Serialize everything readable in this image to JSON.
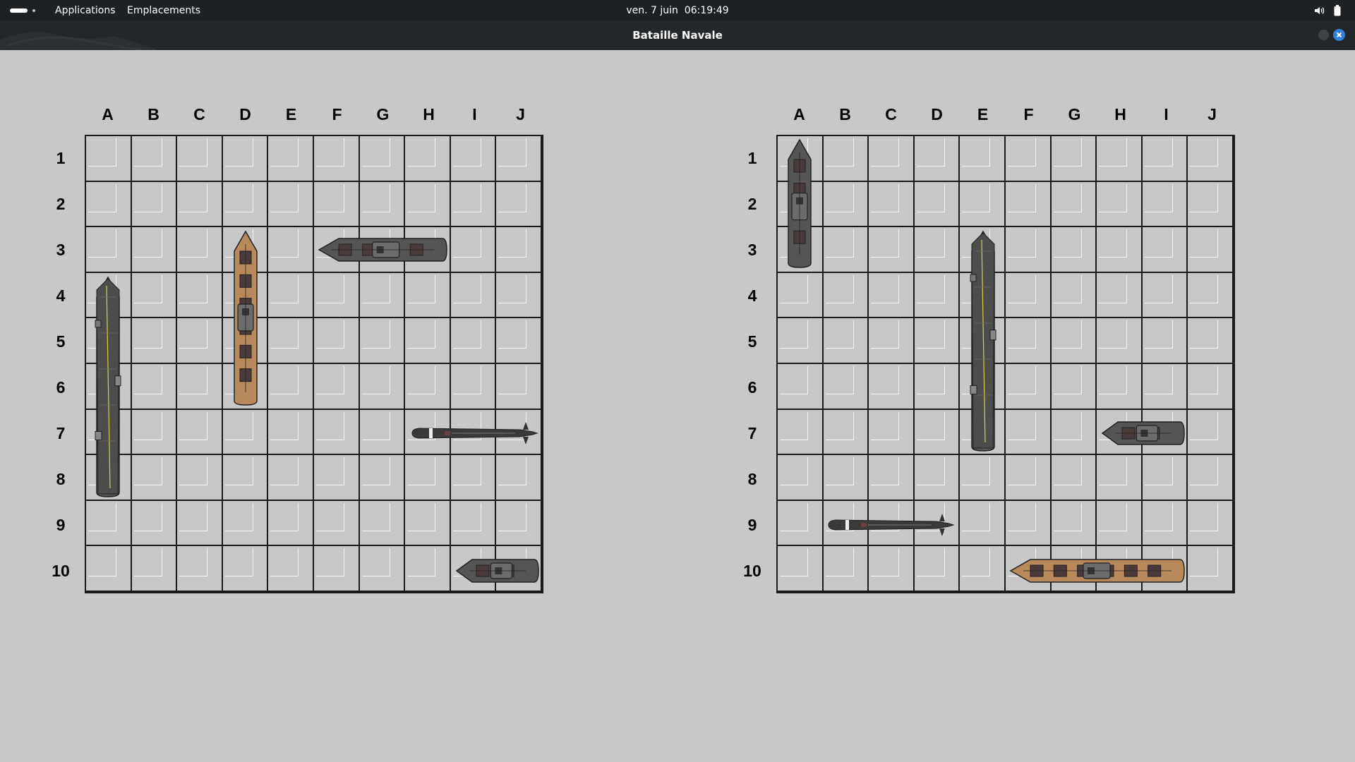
{
  "topbar": {
    "applications_label": "Applications",
    "places_label": "Emplacements",
    "clock": "ven. 7 juin  06:19:49"
  },
  "window": {
    "title": "Bataille Navale"
  },
  "columns": [
    "A",
    "B",
    "C",
    "D",
    "E",
    "F",
    "G",
    "H",
    "I",
    "J"
  ],
  "rows": [
    "1",
    "2",
    "3",
    "4",
    "5",
    "6",
    "7",
    "8",
    "9",
    "10"
  ],
  "colors": {
    "background": "#c8c8c8",
    "grid_lines": "#1a1a1a",
    "ship_gray": "#444444",
    "ship_tan": "#b8895a",
    "close_accent": "#2f7fd8"
  },
  "boards": [
    {
      "name": "left-board",
      "ships": [
        {
          "type": "aircraft-carrier",
          "start": "A4",
          "length": 5,
          "orientation": "vertical"
        },
        {
          "type": "battleship",
          "start": "D3",
          "length": 4,
          "orientation": "vertical"
        },
        {
          "type": "cruiser",
          "start": "F3",
          "length": 3,
          "orientation": "horizontal"
        },
        {
          "type": "submarine",
          "start": "H7",
          "length": 3,
          "orientation": "horizontal"
        },
        {
          "type": "destroyer",
          "start": "I10",
          "length": 2,
          "orientation": "horizontal"
        }
      ]
    },
    {
      "name": "right-board",
      "ships": [
        {
          "type": "cruiser",
          "start": "A1",
          "length": 3,
          "orientation": "vertical"
        },
        {
          "type": "aircraft-carrier",
          "start": "E3",
          "length": 5,
          "orientation": "vertical"
        },
        {
          "type": "destroyer",
          "start": "H7",
          "length": 2,
          "orientation": "horizontal"
        },
        {
          "type": "submarine",
          "start": "B9",
          "length": 3,
          "orientation": "horizontal"
        },
        {
          "type": "battleship",
          "start": "F10",
          "length": 4,
          "orientation": "horizontal"
        }
      ]
    }
  ]
}
